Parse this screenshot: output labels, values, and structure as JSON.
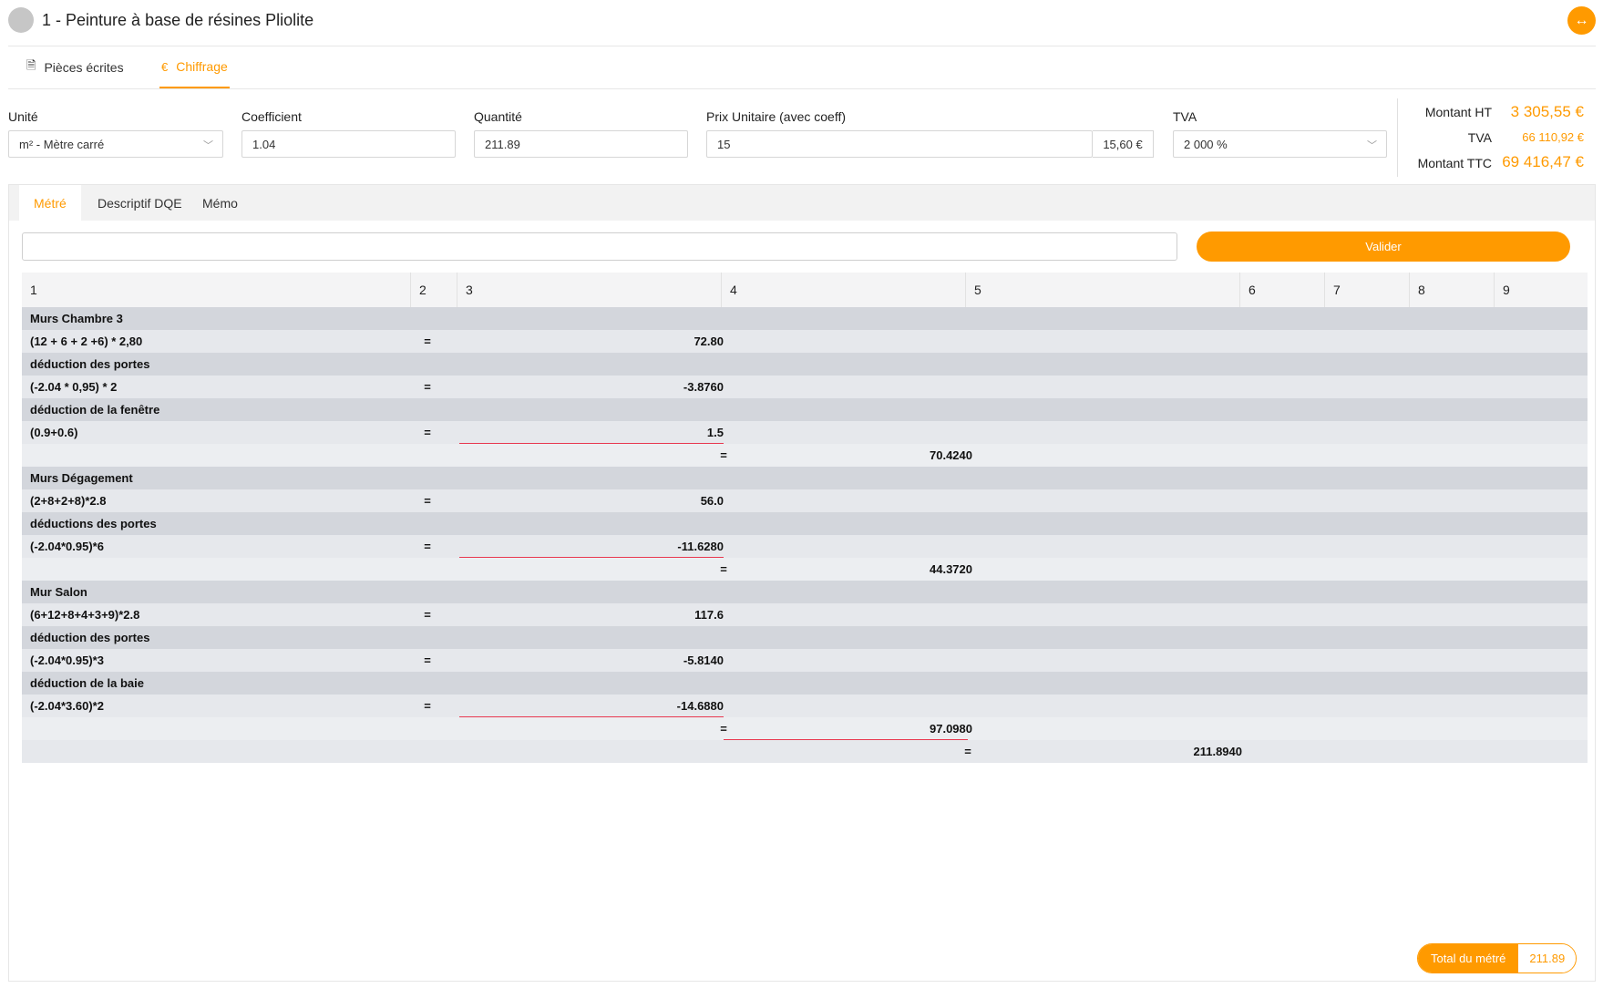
{
  "header": {
    "title": "1 - Peinture à base de résines Pliolite",
    "expand_icon": "↔"
  },
  "top_tabs": [
    {
      "label": "Pièces écrites",
      "icon": "document-icon"
    },
    {
      "label": "Chiffrage",
      "icon": "euro-icon"
    }
  ],
  "form": {
    "unite": {
      "label": "Unité",
      "value": "m² - Mètre carré"
    },
    "coefficient": {
      "label": "Coefficient",
      "value": "1.04"
    },
    "quantite": {
      "label": "Quantité",
      "value": "211.89"
    },
    "prix": {
      "label": "Prix Unitaire (avec coeff)",
      "value": "15",
      "suffix": "15,60 €"
    },
    "tva": {
      "label": "TVA",
      "value": "2 000 %"
    }
  },
  "totals": {
    "ht_label": "Montant HT",
    "ht_value": "3 305,55 €",
    "tva_label": "TVA",
    "tva_value": "66 110,92 €",
    "ttc_label": "Montant TTC",
    "ttc_value": "69 416,47 €"
  },
  "panel_tabs": [
    {
      "label": "Métré"
    },
    {
      "label": "Descriptif DQE"
    },
    {
      "label": "Mémo"
    }
  ],
  "metre": {
    "input_value": "",
    "valider_label": "Valider",
    "columns": [
      "1",
      "2",
      "3",
      "4",
      "5",
      "6",
      "7",
      "8",
      "9"
    ],
    "rows": [
      {
        "text": "Murs Chambre 3"
      },
      {
        "text": "(12 + 6 + 2 +6) * 2,80",
        "eq": "=",
        "value": "72.80"
      },
      {
        "text": "déduction des portes"
      },
      {
        "text": "(-2.04 * 0,95) * 2",
        "eq": "=",
        "value": "-3.8760"
      },
      {
        "text": "déduction de la fenêtre"
      },
      {
        "text": "(0.9+0.6)",
        "eq": "=",
        "value": "1.5"
      },
      {
        "eq": "=",
        "value": "70.4240"
      },
      {
        "text": "Murs Dégagement"
      },
      {
        "text": "(2+8+2+8)*2.8",
        "eq": "=",
        "value": "56.0"
      },
      {
        "text": "déductions des portes"
      },
      {
        "text": "(-2.04*0.95)*6",
        "eq": "=",
        "value": "-11.6280"
      },
      {
        "eq": "=",
        "value": "44.3720"
      },
      {
        "text": "Mur Salon"
      },
      {
        "text": "(6+12+8+4+3+9)*2.8",
        "eq": "=",
        "value": "117.6"
      },
      {
        "text": "déduction des portes"
      },
      {
        "text": "(-2.04*0.95)*3",
        "eq": "=",
        "value": "-5.8140"
      },
      {
        "text": "déduction de la baie"
      },
      {
        "text": "(-2.04*3.60)*2",
        "eq": "=",
        "value": "-14.6880"
      },
      {
        "eq": "=",
        "value": "97.0980"
      },
      {
        "eq": "=",
        "value": "211.8940"
      }
    ],
    "total_label": "Total du métré",
    "total_value": "211.89"
  },
  "colors": {
    "accent": "#ff9a00",
    "underline": "#e8384f"
  }
}
